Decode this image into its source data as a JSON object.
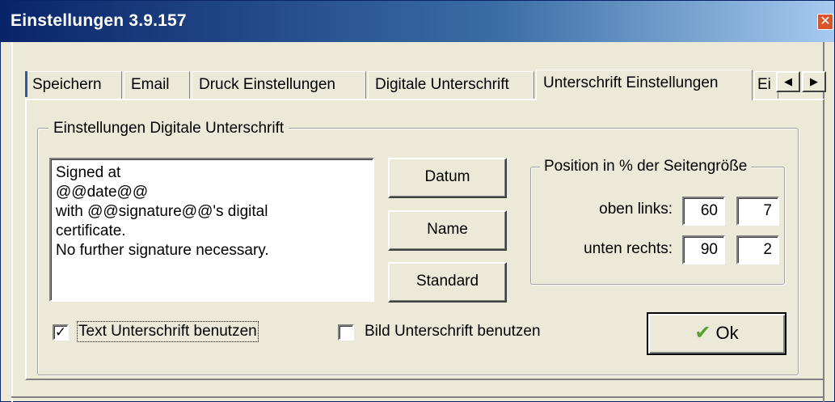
{
  "window": {
    "title": "Einstellungen 3.9.157"
  },
  "tabs": [
    {
      "label": "Speichern"
    },
    {
      "label": "Email"
    },
    {
      "label": "Druck Einstellungen"
    },
    {
      "label": "Digitale Unterschrift"
    },
    {
      "label": "Unterschrift Einstellungen",
      "active": true
    },
    {
      "label": "Ei"
    }
  ],
  "scroll": {
    "left_glyph": "◀",
    "right_glyph": "▶"
  },
  "group": {
    "title": "Einstellungen Digitale Unterschrift"
  },
  "signature_text": "Signed at\n@@date@@\nwith @@signature@@'s digital\ncertificate.\nNo further signature necessary.",
  "buttons": {
    "datum": "Datum",
    "name": "Name",
    "standard": "Standard",
    "ok": "Ok"
  },
  "position": {
    "title": "Position in % der Seitengröße",
    "top_left_label": "oben links:",
    "top_left_x": "60",
    "top_left_y": "7",
    "bottom_right_label": "unten rechts:",
    "bottom_right_x": "90",
    "bottom_right_y": "2"
  },
  "options": {
    "text_signature_label": "Text Unterschrift benutzen",
    "text_signature_checked": true,
    "image_signature_label": "Bild Unterschrift benutzen",
    "image_signature_checked": false
  },
  "icons": {
    "close": "close-icon",
    "ok": "check-icon"
  }
}
